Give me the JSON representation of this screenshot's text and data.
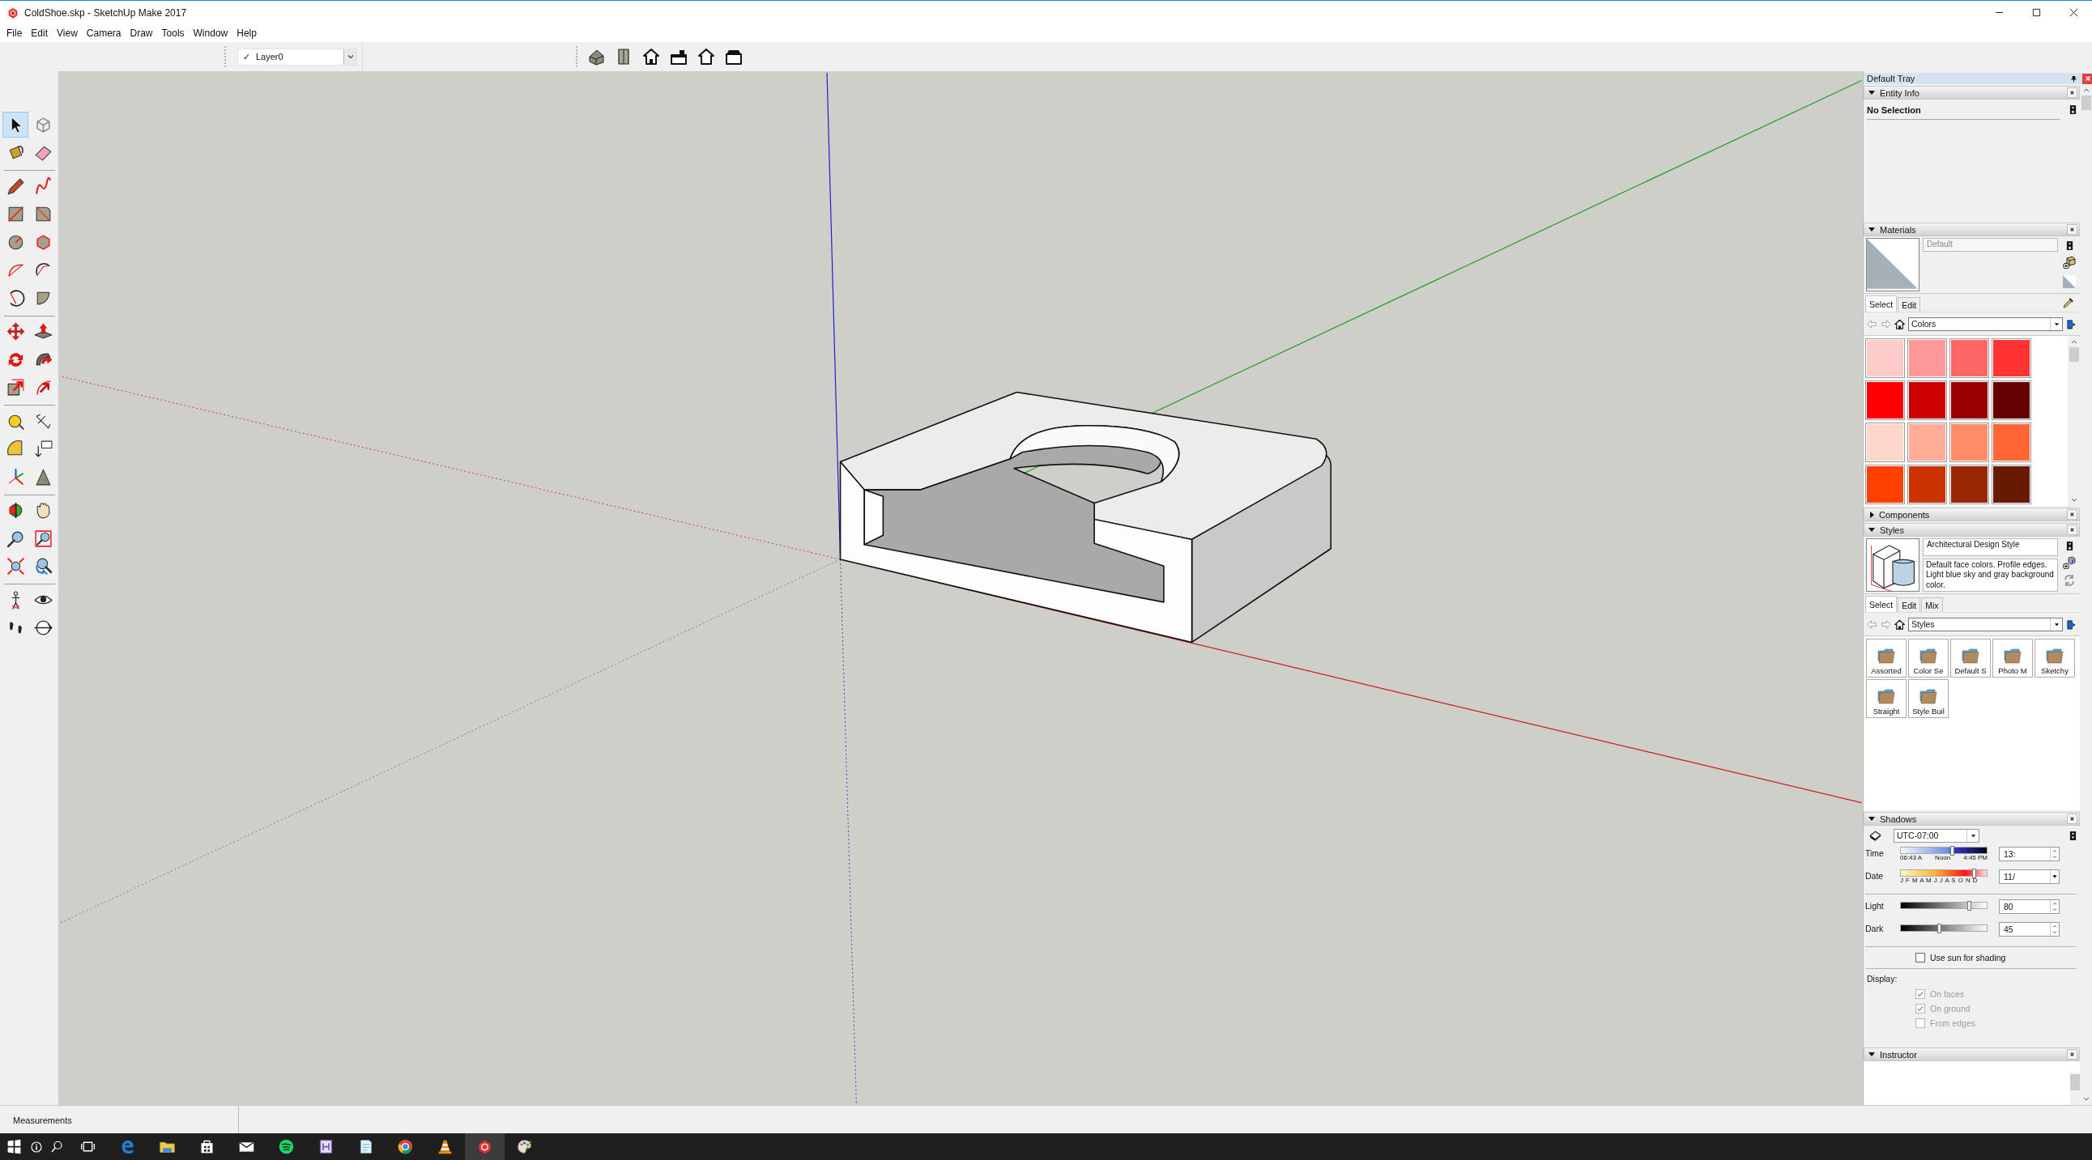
{
  "window": {
    "title": "ColdShoe.skp - SketchUp Make 2017"
  },
  "menu": [
    "File",
    "Edit",
    "View",
    "Camera",
    "Draw",
    "Tools",
    "Window",
    "Help"
  ],
  "layer_selector": {
    "check": "✓",
    "value": "Layer0"
  },
  "tool_groups": [
    [
      {
        "kind": "select",
        "selected": true
      },
      {
        "kind": "component",
        "selected": false
      },
      {
        "kind": "paint",
        "selected": false
      },
      {
        "kind": "eraser",
        "selected": false
      }
    ],
    [
      {
        "kind": "line",
        "selected": false
      },
      {
        "kind": "freehand",
        "selected": false
      },
      {
        "kind": "rectangle",
        "selected": false
      },
      {
        "kind": "rotrect",
        "selected": false
      },
      {
        "kind": "circle",
        "selected": false
      },
      {
        "kind": "polygon",
        "selected": false
      },
      {
        "kind": "arc",
        "selected": false
      },
      {
        "kind": "arc2",
        "selected": false
      },
      {
        "kind": "arc3",
        "selected": false
      },
      {
        "kind": "pie",
        "selected": false
      }
    ],
    [
      {
        "kind": "move",
        "selected": false
      },
      {
        "kind": "pushpull",
        "selected": false
      },
      {
        "kind": "rotate",
        "selected": false
      },
      {
        "kind": "followme",
        "selected": false
      },
      {
        "kind": "scale",
        "selected": false
      },
      {
        "kind": "offset",
        "selected": false
      }
    ],
    [
      {
        "kind": "tape",
        "selected": false
      },
      {
        "kind": "dimension",
        "selected": false
      },
      {
        "kind": "protractor",
        "selected": false
      },
      {
        "kind": "text",
        "selected": false
      },
      {
        "kind": "axes",
        "selected": false
      },
      {
        "kind": "extrudedtext",
        "selected": false
      }
    ],
    [
      {
        "kind": "orbit",
        "selected": false
      },
      {
        "kind": "pan",
        "selected": false
      },
      {
        "kind": "zoom",
        "selected": false
      },
      {
        "kind": "zoomwin",
        "selected": false
      },
      {
        "kind": "zoomext",
        "selected": false
      },
      {
        "kind": "previous",
        "selected": false
      }
    ],
    [
      {
        "kind": "position",
        "selected": false
      },
      {
        "kind": "look",
        "selected": false
      },
      {
        "kind": "walk",
        "selected": false
      },
      {
        "kind": "section",
        "selected": false
      }
    ]
  ],
  "tray": {
    "title": "Default Tray",
    "entity_info": {
      "title": "Entity Info",
      "expanded": true,
      "selection": "No Selection"
    },
    "materials": {
      "title": "Materials",
      "expanded": true,
      "name": "Default",
      "tabs": [
        {
          "label": "Select",
          "selected": true
        },
        {
          "label": "Edit",
          "selected": false
        }
      ],
      "library": "Colors",
      "swatches": [
        {
          "color": "#ffcccc"
        },
        {
          "color": "#ff9999"
        },
        {
          "color": "#ff6666"
        },
        {
          "color": "#ff3333"
        },
        {
          "color": "#ff0000"
        },
        {
          "color": "#cc0000"
        },
        {
          "color": "#990000"
        },
        {
          "color": "#660000"
        },
        {
          "color": "#ffd6cc"
        },
        {
          "color": "#ffad99"
        },
        {
          "color": "#ff8c66"
        },
        {
          "color": "#ff6633"
        },
        {
          "color": "#ff4000"
        },
        {
          "color": "#cc3300"
        },
        {
          "color": "#992600"
        },
        {
          "color": "#661a00"
        }
      ]
    },
    "components": {
      "title": "Components",
      "expanded": false
    },
    "styles": {
      "title": "Styles",
      "expanded": true,
      "style_name": "Architectural Design Style",
      "description": "Default face colors. Profile edges. Light blue sky and gray background color.",
      "tabs": [
        {
          "label": "Select",
          "selected": true
        },
        {
          "label": "Edit",
          "selected": false
        },
        {
          "label": "Mix",
          "selected": false
        }
      ],
      "library": "Styles",
      "folders": [
        {
          "label": "Assorted"
        },
        {
          "label": "Color Se"
        },
        {
          "label": "Default S"
        },
        {
          "label": "Photo M"
        },
        {
          "label": "Sketchy"
        },
        {
          "label": "Straight"
        },
        {
          "label": "Style Buil"
        }
      ]
    },
    "shadows": {
      "title": "Shadows",
      "expanded": true,
      "timezone": "UTC-07:00",
      "time": {
        "label": "Time",
        "marks": [
          "06:43 A",
          "Noon",
          "4:45 PM"
        ],
        "level": 0.6,
        "value": "13:"
      },
      "date": {
        "label": "Date",
        "months": "J F M A M J J A S O N D",
        "level": 0.86,
        "value": "11/"
      },
      "light": {
        "label": "Light",
        "level": 0.8,
        "value": "80"
      },
      "dark": {
        "label": "Dark",
        "level": 0.45,
        "value": "45"
      },
      "use_sun": {
        "label": "Use sun for shading",
        "checked": false
      },
      "display_label": "Display:",
      "display": [
        {
          "label": "On faces",
          "checked": true,
          "disabled": true
        },
        {
          "label": "On ground",
          "checked": true,
          "disabled": true
        },
        {
          "label": "From edges",
          "checked": false,
          "disabled": true
        }
      ]
    },
    "instructor": {
      "title": "Instructor",
      "expanded": true
    }
  },
  "status_bar": {
    "measurements_label": "Measurements"
  },
  "taskbar": [
    {
      "kind": "start",
      "active": false
    },
    {
      "kind": "cortana",
      "active": false
    },
    {
      "kind": "search",
      "active": false
    },
    {
      "kind": "taskview",
      "active": false
    },
    {
      "kind": "edge",
      "active": false
    },
    {
      "kind": "explorer",
      "active": false
    },
    {
      "kind": "store",
      "active": false
    },
    {
      "kind": "mail",
      "active": false
    },
    {
      "kind": "spotify",
      "active": false
    },
    {
      "kind": "hedit",
      "active": false
    },
    {
      "kind": "notepad",
      "active": false
    },
    {
      "kind": "chrome",
      "active": false
    },
    {
      "kind": "vlc",
      "active": false
    },
    {
      "kind": "sketchup",
      "active": true
    },
    {
      "kind": "paint",
      "active": false
    }
  ]
}
